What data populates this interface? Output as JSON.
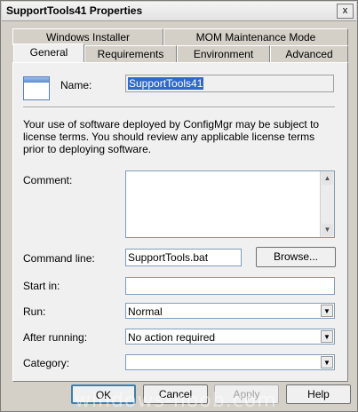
{
  "window": {
    "title": "SupportTools41 Properties",
    "close_glyph": "x"
  },
  "tabs_back": [
    "Windows Installer",
    "MOM Maintenance Mode"
  ],
  "tabs_front": [
    "General",
    "Requirements",
    "Environment",
    "Advanced"
  ],
  "general": {
    "name_label": "Name:",
    "name_value": "SupportTools41",
    "notice": "Your use of software deployed by ConfigMgr may be subject to license terms. You should review any applicable license terms prior to deploying software.",
    "comment_label": "Comment:",
    "comment_value": "",
    "command_label": "Command line:",
    "command_value": "SupportTools.bat",
    "browse_label": "Browse...",
    "startin_label": "Start in:",
    "startin_value": "",
    "run_label": "Run:",
    "run_value": "Normal",
    "after_label": "After running:",
    "after_value": "No action required",
    "category_label": "Category:",
    "category_value": ""
  },
  "buttons": {
    "ok": "OK",
    "cancel": "Cancel",
    "apply": "Apply",
    "help": "Help"
  },
  "watermark": "windows-noob.com",
  "icons": {
    "app": "program-window-icon",
    "up": "scroll-up-arrow",
    "down": "scroll-down-arrow",
    "dropdown": "dropdown-arrow"
  }
}
